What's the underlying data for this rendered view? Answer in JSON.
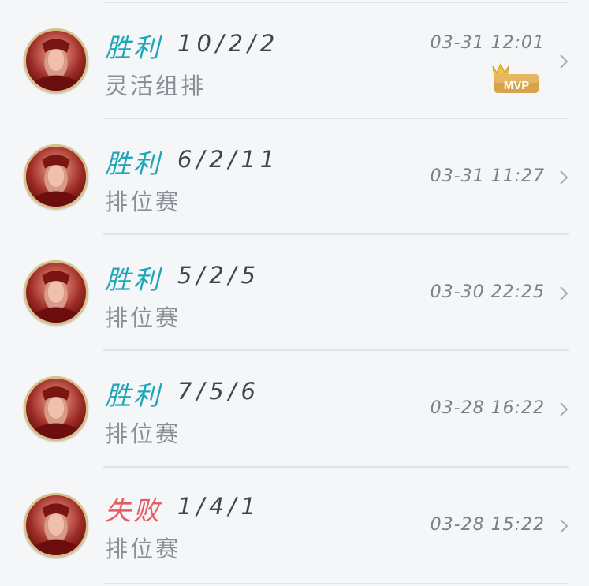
{
  "matches": [
    {
      "result": "胜利",
      "result_type": "win",
      "kda": "10/2/2",
      "mode": "灵活组排",
      "time": "03-31 12:01",
      "mvp": true
    },
    {
      "result": "胜利",
      "result_type": "win",
      "kda": "6/2/11",
      "mode": "排位赛",
      "time": "03-31 11:27",
      "mvp": false
    },
    {
      "result": "胜利",
      "result_type": "win",
      "kda": "5/2/5",
      "mode": "排位赛",
      "time": "03-30 22:25",
      "mvp": false
    },
    {
      "result": "胜利",
      "result_type": "win",
      "kda": "7/5/6",
      "mode": "排位赛",
      "time": "03-28 16:22",
      "mvp": false
    },
    {
      "result": "失败",
      "result_type": "loss",
      "kda": "1/4/1",
      "mode": "排位赛",
      "time": "03-28 15:22",
      "mvp": false
    }
  ],
  "mvp_badge_label": "MVP",
  "colors": {
    "win": "#1fa6b6",
    "loss": "#e65a63",
    "kda": "#3f454b",
    "mode": "#8a9097",
    "time": "#7a8087",
    "divider": "#e1e3e6",
    "background": "#f5f6f8",
    "mvp_badge": "#d8a34a"
  },
  "icons": {
    "avatar": "champion-portrait-icon",
    "chevron": "chevron-right-icon",
    "mvp": "mvp-crown-icon"
  }
}
